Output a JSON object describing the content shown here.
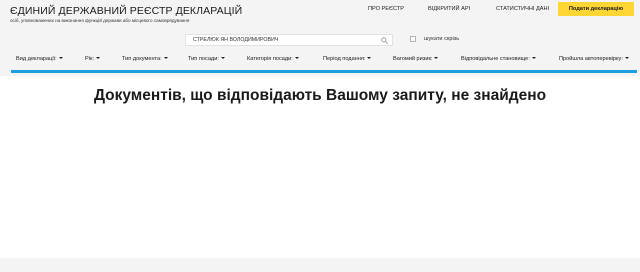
{
  "header": {
    "title": "ЄДИНИЙ ДЕРЖАВНИЙ РЕЄСТР ДЕКЛАРАЦІЙ",
    "subtitle": "осіб, уповноважених на виконання функцій держави або місцевого самоврядування",
    "nav": [
      {
        "label": "ПРО РЕЄСТР"
      },
      {
        "label": "ВІДКРИТИЙ АРІ"
      },
      {
        "label": "СТАТИСТИЧНІ ДАНІ"
      }
    ],
    "cta_label": "Подати декларацію",
    "cta_color": "#ffd633"
  },
  "search": {
    "value": "СТРЕЛЮК ЯН ВОЛОДИМИРОВИЧ",
    "icon": "search-icon",
    "search_everywhere_label": "шукати скрізь",
    "search_everywhere_checked": false
  },
  "filters": [
    {
      "label": "Вид декларації:"
    },
    {
      "label": "Рік:"
    },
    {
      "label": "Тип документа:"
    },
    {
      "label": "Тип посади:"
    },
    {
      "label": "Категорія посади:"
    },
    {
      "label": "Період подання:"
    },
    {
      "label": "Вагомий ризик:"
    },
    {
      "label": "Відповідальне становище:"
    },
    {
      "label": "Пройшла автоперевірку:"
    }
  ],
  "accent_color": "#1ea0e0",
  "results": {
    "empty_message": "Документів, що відповідають Вашому запиту, не знайдено"
  }
}
